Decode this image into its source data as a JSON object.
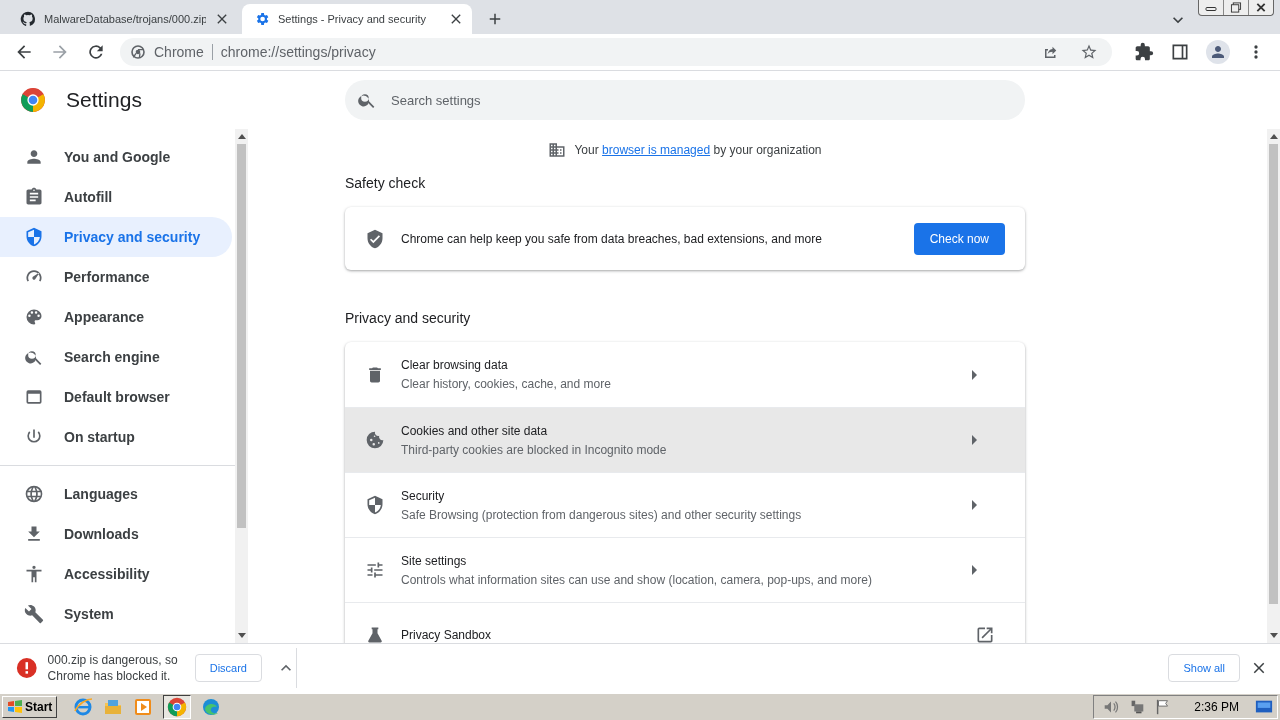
{
  "tabs": [
    {
      "title": "MalwareDatabase/trojans/000.zip",
      "selected": false
    },
    {
      "title": "Settings - Privacy and security",
      "selected": true
    }
  ],
  "omnibox": {
    "chip": "Chrome",
    "url": "chrome://settings/privacy"
  },
  "sidebar": {
    "title": "Settings",
    "groups": [
      [
        {
          "label": "You and Google",
          "selected": false
        },
        {
          "label": "Autofill",
          "selected": false
        },
        {
          "label": "Privacy and security",
          "selected": true
        },
        {
          "label": "Performance",
          "selected": false
        },
        {
          "label": "Appearance",
          "selected": false
        },
        {
          "label": "Search engine",
          "selected": false
        },
        {
          "label": "Default browser",
          "selected": false
        },
        {
          "label": "On startup",
          "selected": false
        }
      ],
      [
        {
          "label": "Languages",
          "selected": false
        },
        {
          "label": "Downloads",
          "selected": false
        },
        {
          "label": "Accessibility",
          "selected": false
        },
        {
          "label": "System",
          "selected": false
        }
      ]
    ]
  },
  "search": {
    "placeholder": "Search settings"
  },
  "managed_notice": {
    "before": "Your",
    "link": "browser is managed",
    "after": "by your organization"
  },
  "safety_check": {
    "heading": "Safety check",
    "text": "Chrome can help keep you safe from data breaches, bad extensions, and more",
    "button": "Check now"
  },
  "privacy": {
    "heading": "Privacy and security",
    "rows": [
      {
        "kind": "arrow",
        "title": "Clear browsing data",
        "subtitle": "Clear history, cookies, cache, and more",
        "highlighted": false
      },
      {
        "kind": "arrow",
        "title": "Cookies and other site data",
        "subtitle": "Third-party cookies are blocked in Incognito mode",
        "highlighted": true
      },
      {
        "kind": "arrow",
        "title": "Security",
        "subtitle": "Safe Browsing (protection from dangerous sites) and other security settings",
        "highlighted": false
      },
      {
        "kind": "arrow",
        "title": "Site settings",
        "subtitle": "Controls what information sites can use and show (location, camera, pop-ups, and more)",
        "highlighted": false
      },
      {
        "kind": "external",
        "title": "Privacy Sandbox",
        "highlighted": false
      }
    ]
  },
  "download_bar": {
    "message": "000.zip is dangerous, so Chrome has blocked it.",
    "discard": "Discard",
    "show_all": "Show all"
  },
  "taskbar": {
    "start": "Start",
    "clock": "2:36 PM"
  }
}
